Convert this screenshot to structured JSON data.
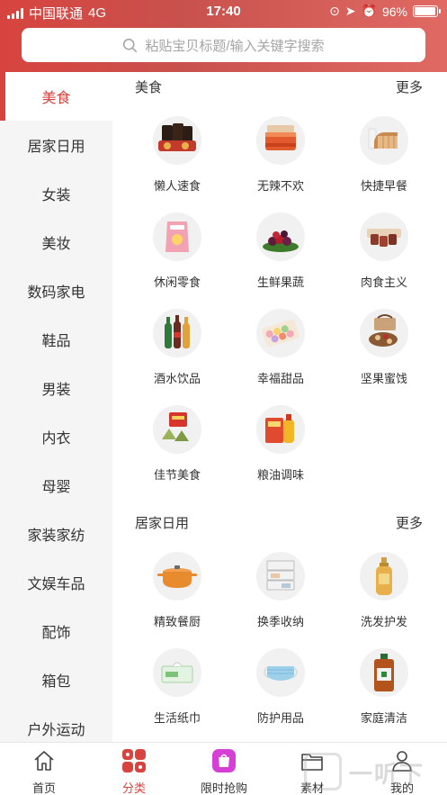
{
  "status": {
    "carrier": "中国联通",
    "network": "4G",
    "time": "17:40",
    "battery": "96%"
  },
  "search": {
    "placeholder": "粘贴宝贝标题/输入关键字搜索"
  },
  "sidebar": {
    "items": [
      {
        "label": "美食"
      },
      {
        "label": "居家日用"
      },
      {
        "label": "女装"
      },
      {
        "label": "美妆"
      },
      {
        "label": "数码家电"
      },
      {
        "label": "鞋品"
      },
      {
        "label": "男装"
      },
      {
        "label": "内衣"
      },
      {
        "label": "母婴"
      },
      {
        "label": "家装家纺"
      },
      {
        "label": "文娱车品"
      },
      {
        "label": "配饰"
      },
      {
        "label": "箱包"
      },
      {
        "label": "户外运动"
      }
    ],
    "active": "美食"
  },
  "sections": [
    {
      "title": "美食",
      "more": "更多",
      "items": [
        {
          "label": "懒人速食"
        },
        {
          "label": "无辣不欢"
        },
        {
          "label": "快捷早餐"
        },
        {
          "label": "休闲零食"
        },
        {
          "label": "生鲜果蔬"
        },
        {
          "label": "肉食主义"
        },
        {
          "label": "酒水饮品"
        },
        {
          "label": "幸福甜品"
        },
        {
          "label": "坚果蜜饯"
        },
        {
          "label": "佳节美食"
        },
        {
          "label": "粮油调味"
        }
      ]
    },
    {
      "title": "居家日用",
      "more": "更多",
      "items": [
        {
          "label": "精致餐厨"
        },
        {
          "label": "换季收纳"
        },
        {
          "label": "洗发护发"
        },
        {
          "label": "生活纸巾"
        },
        {
          "label": "防护用品"
        },
        {
          "label": "家庭清洁"
        }
      ]
    }
  ],
  "tabs": [
    {
      "label": "首页",
      "icon": "home-icon"
    },
    {
      "label": "分类",
      "icon": "category-icon"
    },
    {
      "label": "限时抢购",
      "icon": "flash-sale-icon"
    },
    {
      "label": "素材",
      "icon": "folder-icon"
    },
    {
      "label": "我的",
      "icon": "user-icon"
    }
  ],
  "watermark": "一听下载",
  "colors": {
    "accent": "#d7443f",
    "background": "#f5f5f5"
  }
}
